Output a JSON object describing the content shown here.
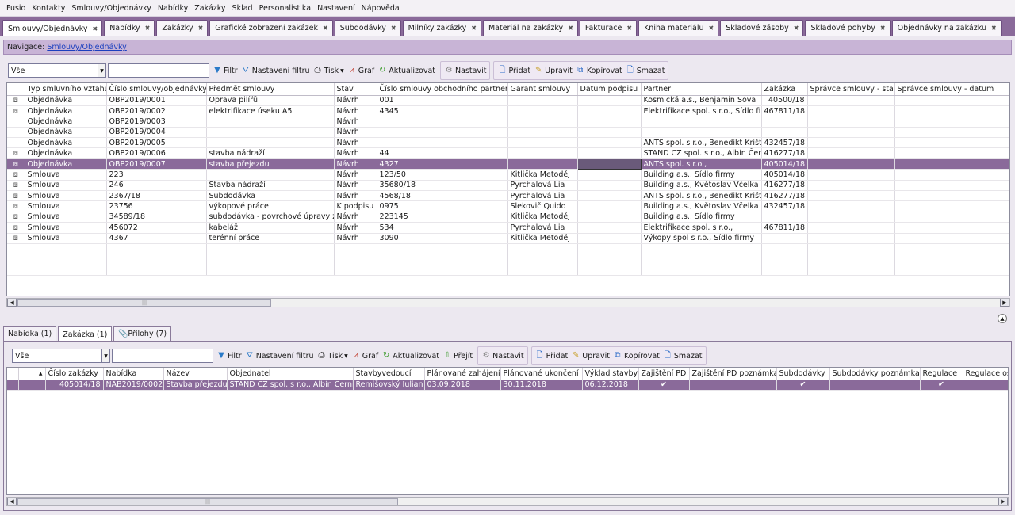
{
  "menu": [
    "Fusio",
    "Kontakty",
    "Smlouvy/Objednávky",
    "Nabídky",
    "Zakázky",
    "Sklad",
    "Personalistika",
    "Nastavení",
    "Nápověda"
  ],
  "tabs": [
    "Smlouvy/Objednávky",
    "Nabídky",
    "Zakázky",
    "Grafické zobrazení zakázek",
    "Subdodávky",
    "Milníky zakázky",
    "Materiál na zakázky",
    "Fakturace",
    "Kniha materiálu",
    "Skladové zásoby",
    "Skladové pohyby",
    "Objednávky na zakázku"
  ],
  "nav": {
    "label": "Navigace:",
    "link": "Smlouvy/Objednávky"
  },
  "toolbar": {
    "filter_value": "Vše",
    "filter": "Filtr",
    "filter_settings": "Nastavení filtru",
    "print": "Tisk",
    "graph": "Graf",
    "refresh": "Aktualizovat",
    "settings": "Nastavit",
    "add": "Přidat",
    "edit": "Upravit",
    "copy": "Kopírovat",
    "delete": "Smazat"
  },
  "main_grid": {
    "columns": [
      "",
      "Typ smluvního vztahu",
      "Číslo smlouvy/objednávky",
      "Předmět smlouvy",
      "Stav",
      "Číslo smlouvy obchodního partnera",
      "Garant smlouvy",
      "Datum podpisu",
      "Partner",
      "Zakázka",
      "Správce smlouvy - stav",
      "Správce smlouvy - datum"
    ],
    "rows": [
      {
        "clip": true,
        "typ": "Objednávka",
        "cislo": "OBP2019/0001",
        "predmet": "Oprava pilířů",
        "stav": "Návrh",
        "cislo_p": "001",
        "garant": "",
        "datum": "",
        "partner": "Kosmická a.s., Benjamin Sova",
        "zakazka": "40500/18"
      },
      {
        "clip": true,
        "typ": "Objednávka",
        "cislo": "OBP2019/0002",
        "predmet": "elektrifikace úseku A5",
        "stav": "Návrh",
        "cislo_p": "4345",
        "garant": "",
        "datum": "",
        "partner": "Elektrifikace spol. s r.o., Sídlo firmy",
        "zakazka": "467811/18"
      },
      {
        "clip": false,
        "typ": "Objednávka",
        "cislo": "OBP2019/0003",
        "predmet": "",
        "stav": "Návrh",
        "cislo_p": "",
        "garant": "",
        "datum": "",
        "partner": "",
        "zakazka": ""
      },
      {
        "clip": false,
        "typ": "Objednávka",
        "cislo": "OBP2019/0004",
        "predmet": "",
        "stav": "Návrh",
        "cislo_p": "",
        "garant": "",
        "datum": "",
        "partner": "",
        "zakazka": ""
      },
      {
        "clip": false,
        "typ": "Objednávka",
        "cislo": "OBP2019/0005",
        "predmet": "",
        "stav": "Návrh",
        "cislo_p": "",
        "garant": "",
        "datum": "",
        "partner": "ANTS spol. s r.o., Benedikt Krištof",
        "zakazka": "432457/18"
      },
      {
        "clip": true,
        "typ": "Objednávka",
        "cislo": "OBP2019/0006",
        "predmet": "stavba nádraží",
        "stav": "Návrh",
        "cislo_p": "44",
        "garant": "",
        "datum": "",
        "partner": "STAND CZ spol. s r.o., Albín Černič",
        "zakazka": "416277/18"
      },
      {
        "clip": true,
        "typ": "Objednávka",
        "cislo": "OBP2019/0007",
        "predmet": "stavba přejezdu",
        "stav": "Návrh",
        "cislo_p": "4327",
        "garant": "",
        "datum": "",
        "partner": "ANTS spol. s r.o.,",
        "zakazka": "405014/18",
        "selected": true
      },
      {
        "clip": true,
        "typ": "Smlouva",
        "cislo": "223",
        "predmet": "",
        "stav": "Návrh",
        "cislo_p": "123/50",
        "garant": "Kitlička Metoděj",
        "datum": "",
        "partner": "Building a.s., Sídlo firmy",
        "zakazka": "405014/18"
      },
      {
        "clip": true,
        "typ": "Smlouva",
        "cislo": "246",
        "predmet": "Stavba nádraží",
        "stav": "Návrh",
        "cislo_p": "35680/18",
        "garant": "Pyrchalová Lia",
        "datum": "",
        "partner": "Building a.s., Květoslav Včelka",
        "zakazka": "416277/18"
      },
      {
        "clip": true,
        "typ": "Smlouva",
        "cislo": "2367/18",
        "predmet": "Subdodávka",
        "stav": "Návrh",
        "cislo_p": "4568/18",
        "garant": "Pyrchalová Lia",
        "datum": "",
        "partner": "ANTS spol. s r.o., Benedikt Krištof",
        "zakazka": "416277/18"
      },
      {
        "clip": true,
        "typ": "Smlouva",
        "cislo": "23756",
        "predmet": "výkopové práce",
        "stav": "K podpisu",
        "cislo_p": "0975",
        "garant": "Slekovič Quido",
        "datum": "",
        "partner": "Building a.s., Květoslav Včelka",
        "zakazka": "432457/18"
      },
      {
        "clip": true,
        "typ": "Smlouva",
        "cislo": "34589/18",
        "predmet": "subdodávka - povrchové úpravy zdi",
        "stav": "Návrh",
        "cislo_p": "223145",
        "garant": "Kitlička Metoděj",
        "datum": "",
        "partner": "Building a.s., Sídlo firmy",
        "zakazka": ""
      },
      {
        "clip": true,
        "typ": "Smlouva",
        "cislo": "456072",
        "predmet": "kabeláž",
        "stav": "Návrh",
        "cislo_p": "534",
        "garant": "Pyrchalová Lia",
        "datum": "",
        "partner": "Elektrifikace spol. s r.o.,",
        "zakazka": "467811/18"
      },
      {
        "clip": true,
        "typ": "Smlouva",
        "cislo": "4367",
        "predmet": "terénní práce",
        "stav": "Návrh",
        "cislo_p": "3090",
        "garant": "Kitlička Metoděj",
        "datum": "",
        "partner": "Výkopy spol s r.o., Sídlo firmy",
        "zakazka": ""
      }
    ]
  },
  "subtabs": [
    "Nabídka (1)",
    "Zakázka (1)",
    "Přílohy (7)"
  ],
  "sub_toolbar": {
    "goto": "Přejít"
  },
  "sub_grid": {
    "columns": [
      "",
      "Číslo zakázky",
      "Nabídka",
      "Název",
      "Objednatel",
      "Stavbyvedoucí",
      "Plánované zahájení",
      "Plánované ukončení",
      "Výklad stavby",
      "Zajištění PD",
      "Zajištění PD poznámka",
      "Subdodávky",
      "Subdodávky poznámka",
      "Regulace",
      "Regulace oso"
    ],
    "rows": [
      {
        "cislo": "405014/18",
        "nabidka": "NAB2019/0002",
        "nazev": "Stavba přejezdu",
        "objednatel": "STAND CZ spol. s r.o., Albín Černič",
        "stavbyvedouci": "Remišovský Iulian",
        "zahajeni": "03.09.2018",
        "ukonceni": "30.11.2018",
        "vyklad": "06.12.2018",
        "pd": true,
        "subd": true,
        "regulace": true
      }
    ]
  }
}
